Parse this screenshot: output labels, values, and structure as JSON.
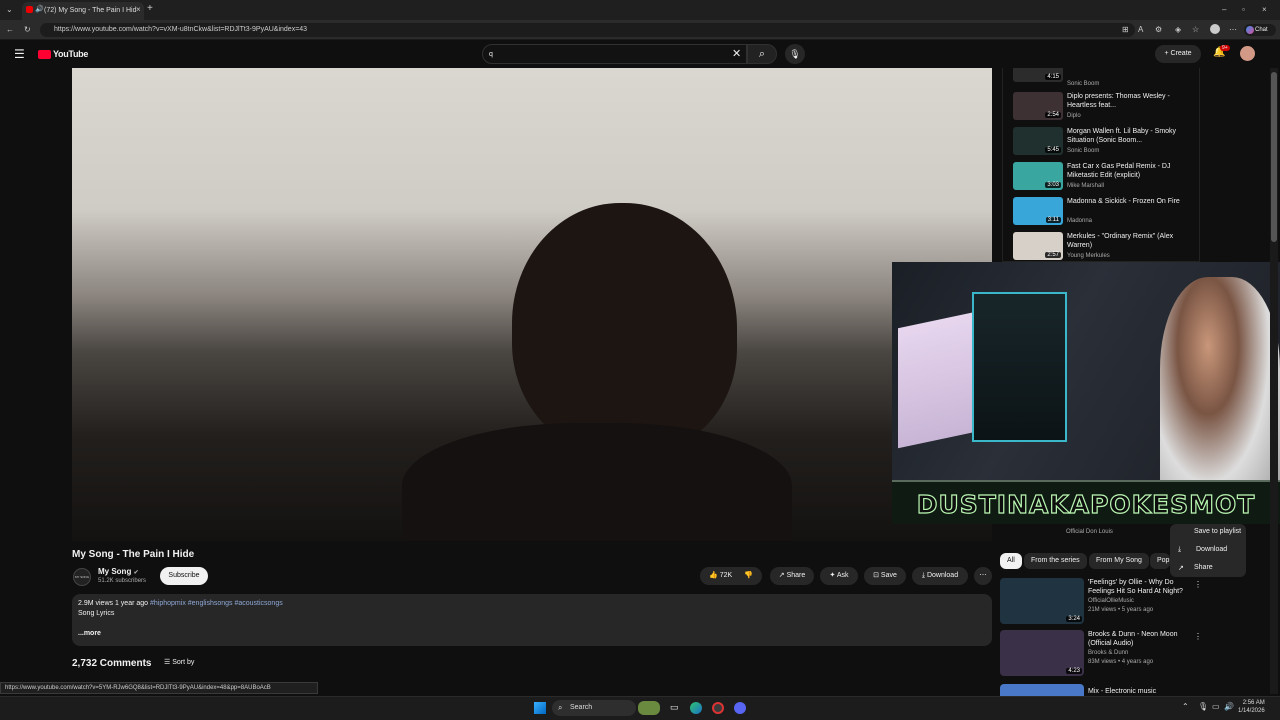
{
  "browser": {
    "tab_title": "(72) My Song - The Pain I Hid",
    "url": "https://www.youtube.com/watch?v=vXM-u8tnCkw&list=RDJlTt3-9PyAU&index=43",
    "chat_label": "Chat"
  },
  "header": {
    "logo": "YouTube",
    "search_value": "q",
    "create_label": "Create",
    "notif_count": "9+"
  },
  "playlist": {
    "items": [
      {
        "title": "",
        "channel": "Sonic Boom",
        "duration": "4:15"
      },
      {
        "title": "Diplo presents: Thomas Wesley - Heartless feat...",
        "channel": "Diplo",
        "duration": "2:54"
      },
      {
        "title": "Morgan Wallen ft. Lil Baby - Smoky Situation (Sonic Boom...",
        "channel": "Sonic Boom",
        "duration": "5:45"
      },
      {
        "title": "Fast Car x Gas Pedal Remix - DJ Miketastic Edit (explicit)",
        "channel": "Mike Marshall",
        "duration": "3:03"
      },
      {
        "title": "Madonna & Sickick - Frozen On Fire",
        "channel": "Madonna",
        "duration": "3:11"
      },
      {
        "title": "Merkules - \"Ordinary Remix\" (Alex Warren)",
        "channel": "Young Merkules",
        "duration": "2:57"
      }
    ]
  },
  "overlay": {
    "banner_text": "DUSTINAKAPOKESMOT"
  },
  "video": {
    "title": "My Song - The Pain I Hide",
    "channel": "My Song",
    "avatar_text": "MY SONG",
    "subscribers": "51.2K subscribers",
    "subscribe_label": "Subscribe",
    "likes": "72K",
    "share_label": "Share",
    "ask_label": "Ask",
    "save_label": "Save",
    "download_label": "Download",
    "views": "2.9M views",
    "age": "1 year ago",
    "tags": "#hiphopmix #englishsongs #acousticsongs",
    "description": "Song Lyrics",
    "more_label": "...more",
    "comments_count": "2,732 Comments",
    "sort_label": "Sort by"
  },
  "right_panel": {
    "partial_channel": "Official Don Louis",
    "chips": [
      "All",
      "From the series",
      "From My Song",
      "Pop"
    ],
    "context_menu": [
      "Save to playlist",
      "Download",
      "Share"
    ],
    "videos": [
      {
        "title": "'Feelings' by Ollie - Why Do Feelings Hit So Hard At Night?",
        "channel": "OfficialOllieMusic",
        "meta": "21M views • 5 years ago",
        "duration": "3:24"
      },
      {
        "title": "Brooks & Dunn - Neon Moon (Official Audio)",
        "channel": "Brooks & Dunn",
        "meta": "83M views • 4 years ago",
        "duration": "4:23"
      },
      {
        "title": "Mix - Electronic music",
        "channel": "",
        "meta": "",
        "duration": ""
      }
    ]
  },
  "status_url": "https://www.youtube.com/watch?v=5YM-RJw6GQ8&list=RDJlTt3-9PyAU&index=48&pp=8AUBoAcB",
  "taskbar": {
    "search_label": "Search",
    "time": "2:56 AM",
    "date": "1/14/2026"
  }
}
